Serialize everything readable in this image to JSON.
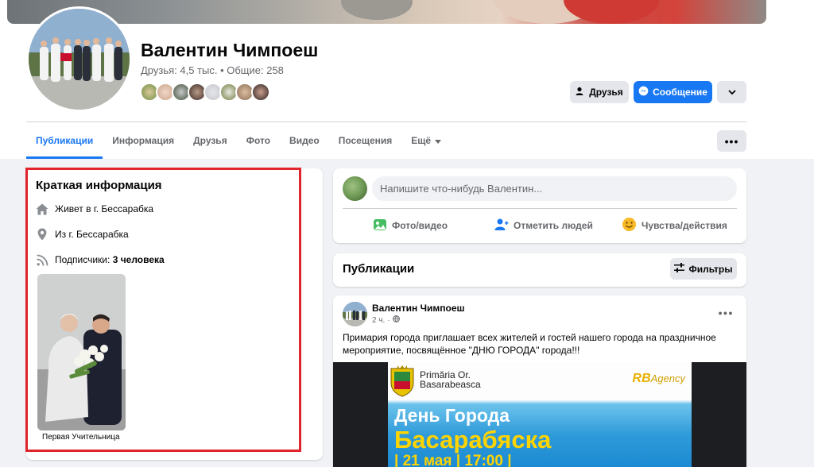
{
  "profile": {
    "name": "Валентин Чимпоеш",
    "friends_line": "Друзья: 4,5 тыс. • Общие: 258",
    "mutual_friends_count_shown": 8
  },
  "actions": {
    "friends_label": "Друзья",
    "message_label": "Сообщение"
  },
  "tabs": [
    {
      "label": "Публикации",
      "active": true
    },
    {
      "label": "Информация",
      "active": false
    },
    {
      "label": "Друзья",
      "active": false
    },
    {
      "label": "Фото",
      "active": false
    },
    {
      "label": "Видео",
      "active": false
    },
    {
      "label": "Посещения",
      "active": false
    },
    {
      "label": "Ещё",
      "active": false
    }
  ],
  "intro": {
    "title": "Краткая информация",
    "lives_prefix": "Живет в г. ",
    "lives_city": "Бессарабка",
    "from_prefix": "Из г. ",
    "from_city": "Бессарабка",
    "followers_prefix": "Подписчики: ",
    "followers_value": "3 человека",
    "photo_caption": "Первая Учительница"
  },
  "composer": {
    "placeholder": "Напишите что-нибудь Валентин...",
    "photo_video": "Фото/видео",
    "tag_people": "Отметить людей",
    "feelings": "Чувства/действия"
  },
  "publications": {
    "title": "Публикации",
    "filters_label": "Фильтры"
  },
  "post": {
    "author": "Валентин Чимпоеш",
    "time": "2 ч.",
    "separator": "·",
    "text": "Примария города приглашает всех жителей и гостей нашего города на праздничное мероприятие, посвящённое  \"ДНЮ ГОРОДА\" города!!!",
    "poster": {
      "org_line1": "Primăria Or.",
      "org_line2": "Basarabeasca",
      "agency_main": "RB",
      "agency_sub": "Agency",
      "day": "День Города",
      "city": "Басарабяска",
      "date": "| 21 мая | 17:00 |"
    }
  },
  "colors": {
    "accent": "#1877f2",
    "highlight_box": "#e1232b",
    "page_bg": "#f0f2f5"
  },
  "icons": {
    "home": "home-icon",
    "pin": "location-pin-icon",
    "rss": "followers-rss-icon"
  }
}
